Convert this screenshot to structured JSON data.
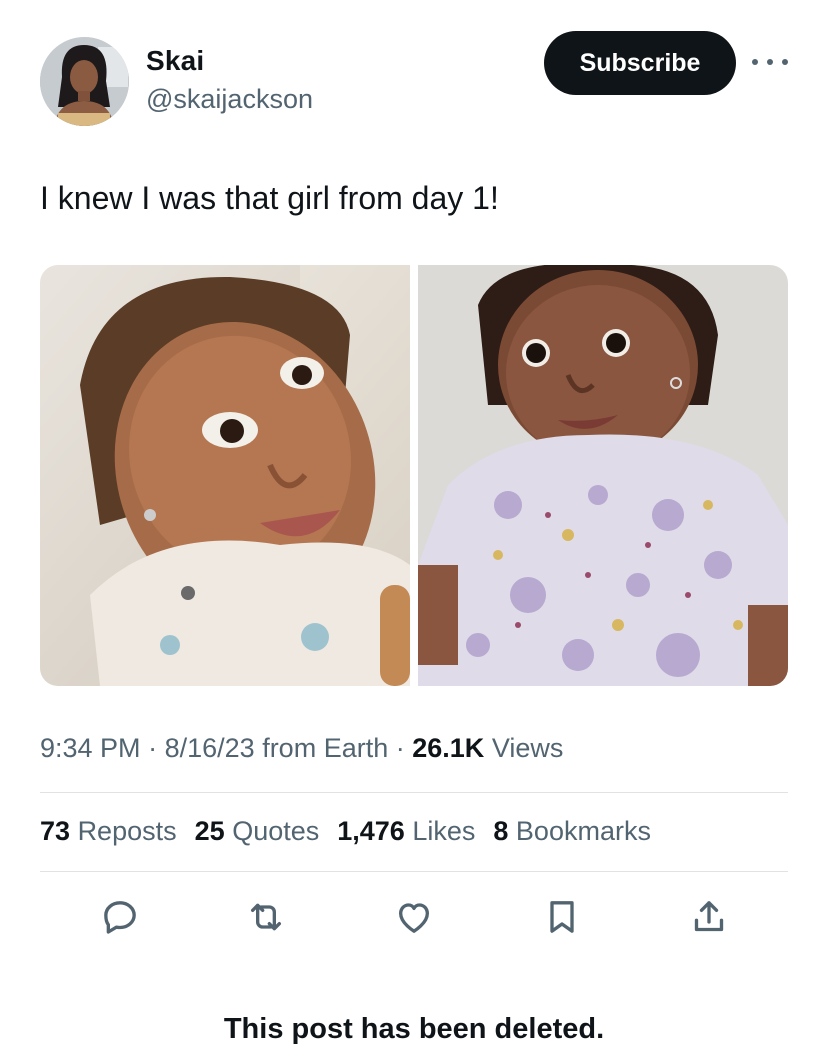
{
  "author": {
    "display_name": "Skai",
    "handle": "@skaijackson"
  },
  "header": {
    "subscribe_label": "Subscribe",
    "more_icon": "more-horizontal-icon"
  },
  "post": {
    "text": "I knew I was that girl from day 1!",
    "time": "9:34 PM",
    "date": "8/16/23",
    "source": "from Earth",
    "views_count": "26.1K",
    "views_label": "Views"
  },
  "stats": {
    "reposts_count": "73",
    "reposts_label": "Reposts",
    "quotes_count": "25",
    "quotes_label": "Quotes",
    "likes_count": "1,476",
    "likes_label": "Likes",
    "bookmarks_count": "8",
    "bookmarks_label": "Bookmarks"
  },
  "actions": [
    "reply-icon",
    "repost-icon",
    "like-icon",
    "bookmark-icon",
    "share-icon"
  ],
  "footer": {
    "notice": "This post has been deleted."
  },
  "colors": {
    "text_primary": "#0f1419",
    "text_secondary": "#536471",
    "button_bg": "#0f1419",
    "divider": "#dfe3e6"
  }
}
